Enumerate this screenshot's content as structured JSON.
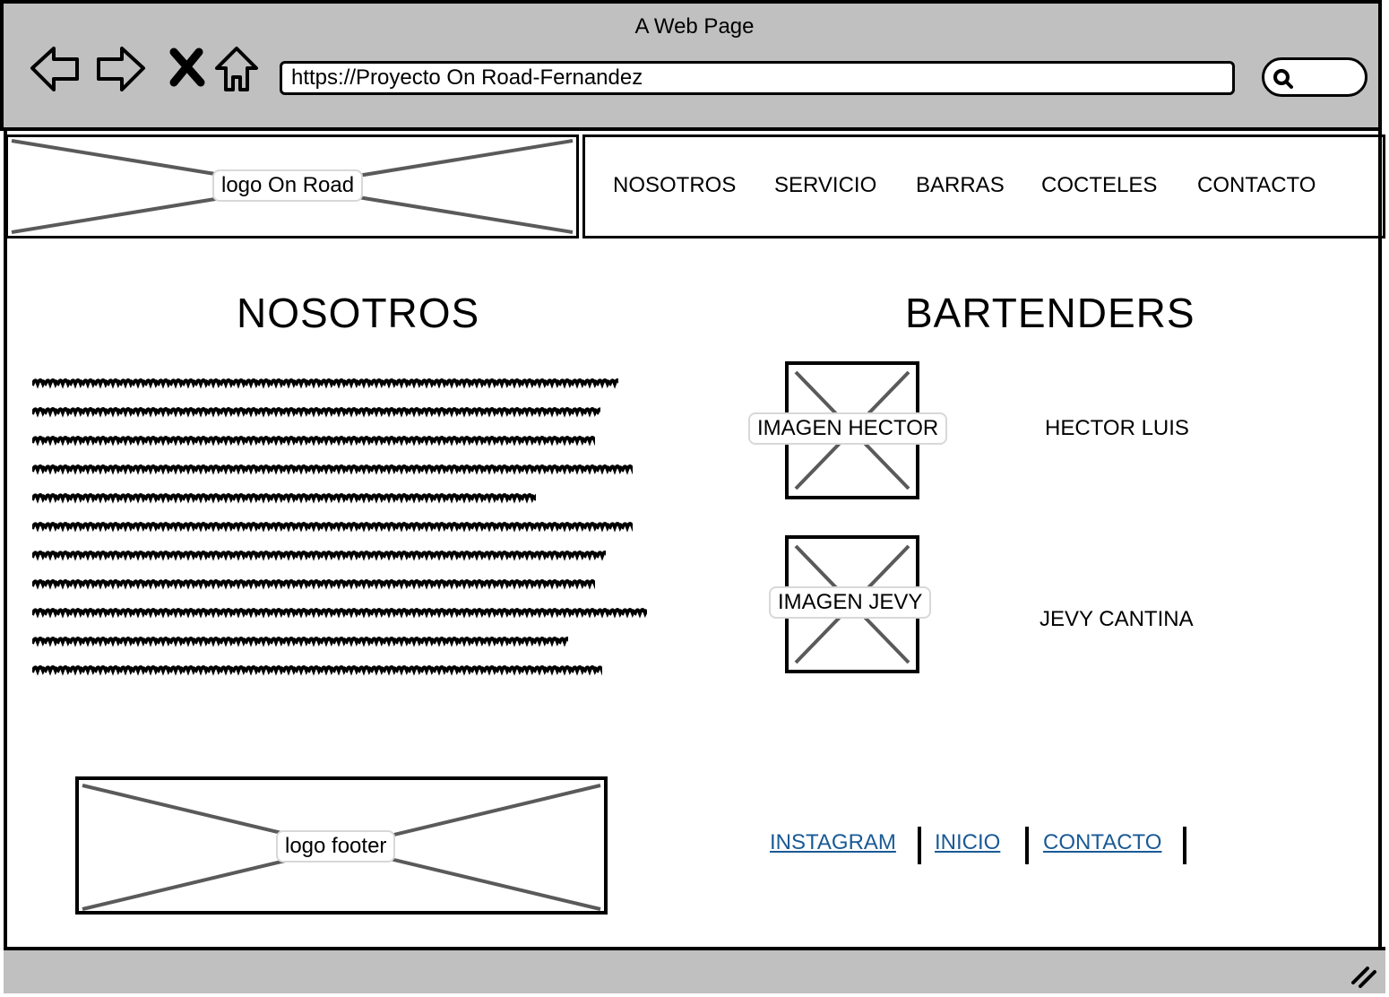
{
  "browser": {
    "window_title": "A Web Page",
    "url": "https://Proyecto On Road-Fernandez",
    "icons": [
      "back-arrow-icon",
      "forward-arrow-icon",
      "close-x-icon",
      "home-icon",
      "search-icon",
      "resize-grip-icon"
    ]
  },
  "header": {
    "logo_label": "logo On Road",
    "nav": [
      "NOSOTROS",
      "SERVICIO",
      "BARRAS",
      "COCTELES",
      "CONTACTO"
    ]
  },
  "about": {
    "title": "NOSOTROS"
  },
  "bartenders": {
    "title": "BARTENDERS",
    "people": [
      {
        "image_label": "IMAGEN HECTOR",
        "name": "HECTOR LUIS"
      },
      {
        "image_label": "IMAGEN JEVY",
        "name": "JEVY CANTINA"
      }
    ]
  },
  "footer": {
    "logo_label": "logo footer",
    "links": [
      "INSTAGRAM",
      "INICIO",
      "CONTACTO"
    ]
  },
  "colors": {
    "chrome": "#c0c0c0",
    "link": "#1a5a96",
    "placeholder_cross": "#5a5a5a"
  }
}
